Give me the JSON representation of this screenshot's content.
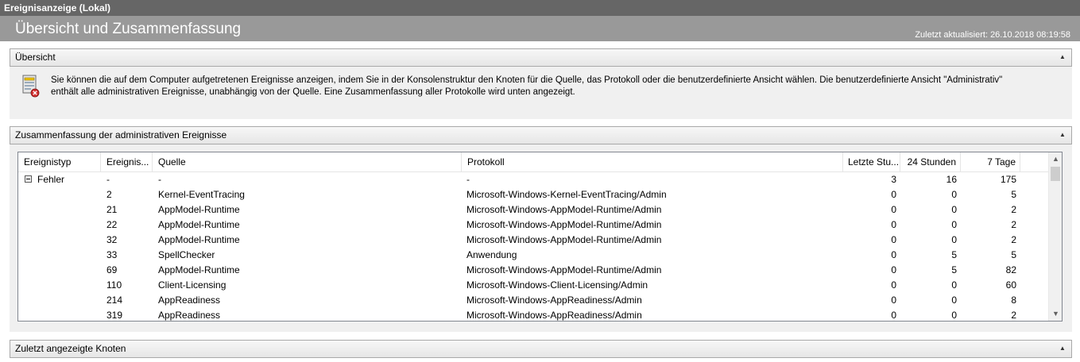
{
  "window_title": "Ereignisanzeige (Lokal)",
  "header": {
    "title": "Übersicht und Zusammenfassung",
    "last_updated": "Zuletzt aktualisiert: 26.10.2018 08:19:58"
  },
  "sections": {
    "overview": {
      "title": "Übersicht",
      "text_line1": "Sie können die auf dem Computer aufgetretenen Ereignisse anzeigen, indem Sie in der Konsolenstruktur den Knoten für die Quelle, das Protokoll oder die benutzerdefinierte Ansicht wählen. Die benutzerdefinierte Ansicht \"Administrativ\"",
      "text_line2": "enthält alle administrativen Ereignisse, unabhängig von der Quelle. Eine Zusammenfassung aller Protokolle wird unten angezeigt."
    },
    "summary": {
      "title": "Zusammenfassung der administrativen Ereignisse",
      "columns": [
        "Ereignistyp",
        "Ereignis...",
        "Quelle",
        "Protokoll",
        "Letzte Stu...",
        "24 Stunden",
        "7 Tage"
      ],
      "rows": [
        {
          "type": "Fehler",
          "id": "-",
          "source": "-",
          "log": "-",
          "hour": "3",
          "day": "16",
          "week": "175"
        },
        {
          "type": "",
          "id": "2",
          "source": "Kernel-EventTracing",
          "log": "Microsoft-Windows-Kernel-EventTracing/Admin",
          "hour": "0",
          "day": "0",
          "week": "5"
        },
        {
          "type": "",
          "id": "21",
          "source": "AppModel-Runtime",
          "log": "Microsoft-Windows-AppModel-Runtime/Admin",
          "hour": "0",
          "day": "0",
          "week": "2"
        },
        {
          "type": "",
          "id": "22",
          "source": "AppModel-Runtime",
          "log": "Microsoft-Windows-AppModel-Runtime/Admin",
          "hour": "0",
          "day": "0",
          "week": "2"
        },
        {
          "type": "",
          "id": "32",
          "source": "AppModel-Runtime",
          "log": "Microsoft-Windows-AppModel-Runtime/Admin",
          "hour": "0",
          "day": "0",
          "week": "2"
        },
        {
          "type": "",
          "id": "33",
          "source": "SpellChecker",
          "log": "Anwendung",
          "hour": "0",
          "day": "5",
          "week": "5"
        },
        {
          "type": "",
          "id": "69",
          "source": "AppModel-Runtime",
          "log": "Microsoft-Windows-AppModel-Runtime/Admin",
          "hour": "0",
          "day": "5",
          "week": "82"
        },
        {
          "type": "",
          "id": "110",
          "source": "Client-Licensing",
          "log": "Microsoft-Windows-Client-Licensing/Admin",
          "hour": "0",
          "day": "0",
          "week": "60"
        },
        {
          "type": "",
          "id": "214",
          "source": "AppReadiness",
          "log": "Microsoft-Windows-AppReadiness/Admin",
          "hour": "0",
          "day": "0",
          "week": "8"
        },
        {
          "type": "",
          "id": "319",
          "source": "AppReadiness",
          "log": "Microsoft-Windows-AppReadiness/Admin",
          "hour": "0",
          "day": "0",
          "week": "2"
        }
      ]
    },
    "recent": {
      "title": "Zuletzt angezeigte Knoten"
    }
  },
  "icons": {
    "collapse": "chevron-up-icon",
    "info": "event-log-icon",
    "scroll_up": "arrow-up-icon",
    "scroll_down": "arrow-down-icon"
  }
}
